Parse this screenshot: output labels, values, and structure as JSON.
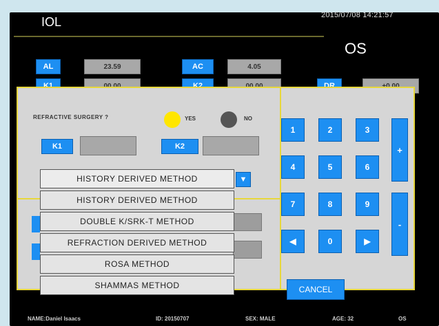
{
  "header": {
    "title": "IOL",
    "datetime": "2015/07/08  14:21:57",
    "eye": "OS"
  },
  "measurements": {
    "al_label": "AL",
    "al_value": "23.59",
    "k1_label": "K1",
    "k1_value": "00.00",
    "ac_label": "AC",
    "ac_value": "4.05",
    "k2_label": "K2",
    "k2_value": "00.00",
    "dr_label": "DR",
    "dr_value": "+0.00"
  },
  "refractive": {
    "label": "REFRACTIVE SURGERY ?",
    "yes_label": "YES",
    "no_label": "NO",
    "yes_color": "#ffe600",
    "no_color": "#555555",
    "k1_label": "K1",
    "k2_label": "K2"
  },
  "method_dropdown": {
    "selected": "HISTORY DERIVED METHOD",
    "options": [
      "HISTORY DERIVED METHOD",
      "DOUBLE K/SRK-T METHOD",
      "REFRACTION DERIVED METHOD",
      "ROSA METHOD",
      "SHAMMAS METHOD"
    ]
  },
  "keypad": {
    "k1": "1",
    "k2": "2",
    "k3": "3",
    "k4": "4",
    "k5": "5",
    "k6": "6",
    "k7": "7",
    "k8": "8",
    "k9": "9",
    "k0": "0",
    "plus": "+",
    "minus": "-",
    "left_icon": "left-arrow-icon",
    "right_icon": "right-arrow-icon"
  },
  "cancel_label": "CANCEL",
  "footer": {
    "name": "NAME:Daniel  Isaacs",
    "id": "ID: 20150707",
    "sex": "SEX: MALE",
    "age": "AGE: 32",
    "eye": "OS"
  },
  "colors": {
    "accent_blue": "#1d8ff2",
    "panel_border": "#e7d73b"
  }
}
